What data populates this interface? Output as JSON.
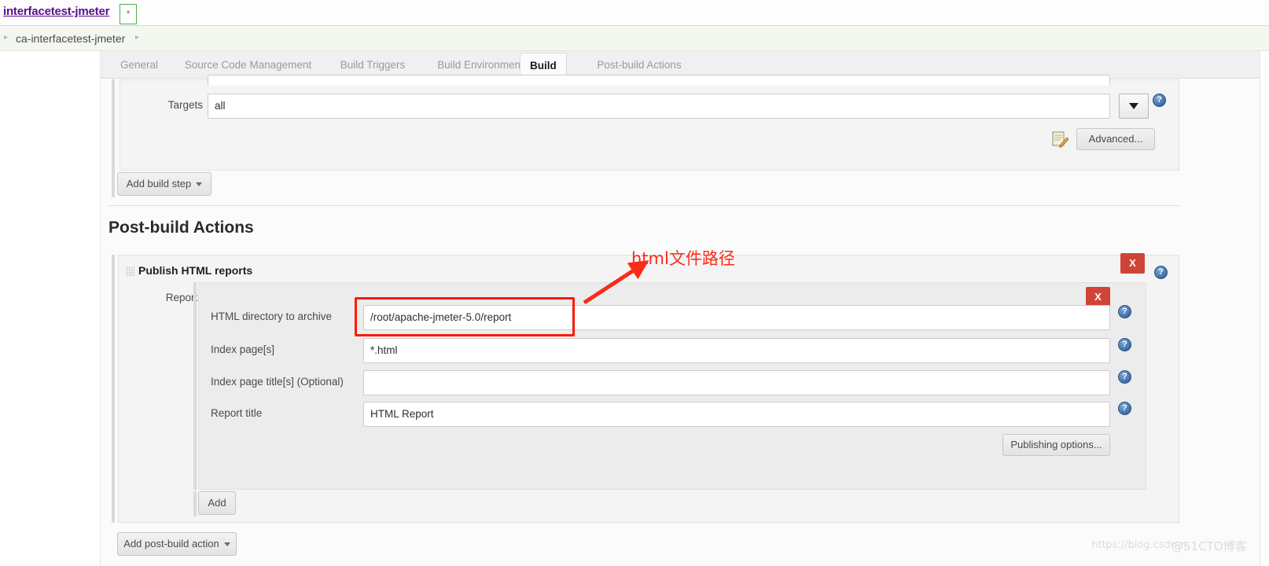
{
  "window": {
    "title": "interfacetest-jmeter",
    "modified_marker": "*"
  },
  "breadcrumb": {
    "items": [
      "ca-interfacetest-jmeter"
    ],
    "leading_caret": "▸",
    "trailing_caret": "▸"
  },
  "tabs": [
    {
      "label": "General",
      "active": false
    },
    {
      "label": "Source Code Management",
      "active": false
    },
    {
      "label": "Build Triggers",
      "active": false
    },
    {
      "label": "Build Environment",
      "active": false
    },
    {
      "label": "Build",
      "active": true
    },
    {
      "label": "Post-build Actions",
      "active": false
    }
  ],
  "build_section": {
    "targets_label": "Targets",
    "targets_value": "all",
    "dropdown_icon": "chevron-down-icon",
    "advanced_label": "Advanced...",
    "note_icon": "notepad-pencil-icon",
    "add_build_step_label": "Add build step",
    "help_icon": "?"
  },
  "post_build": {
    "heading": "Post-build Actions",
    "publisher_title": "Publish HTML reports",
    "reports_label": "Reports",
    "fields": [
      {
        "label": "HTML directory to archive",
        "value": "/root/apache-jmeter-5.0/report",
        "placeholder": "",
        "highlighted": true
      },
      {
        "label": "Index page[s]",
        "value": "*.html",
        "placeholder": "",
        "highlighted": false
      },
      {
        "label": "Index page title[s] (Optional)",
        "value": "",
        "placeholder": "",
        "highlighted": false
      },
      {
        "label": "Report title",
        "value": "HTML Report",
        "placeholder": "",
        "highlighted": false
      }
    ],
    "publishing_options_label": "Publishing options...",
    "add_label": "Add",
    "add_post_build_action_label": "Add post-build action",
    "remove_label": "X",
    "help_icon": "?"
  },
  "annotation": {
    "text": "html文件路径",
    "color": "#fb2b1a"
  },
  "watermark": {
    "text": "https://blog.csdn.n",
    "text2": "@51CTO博客"
  },
  "colors": {
    "accent_red": "#cf4436",
    "annotation_red": "#fb1a08",
    "link_purple": "#5b0f8b",
    "tab_active_text": "#1a1a1a"
  }
}
